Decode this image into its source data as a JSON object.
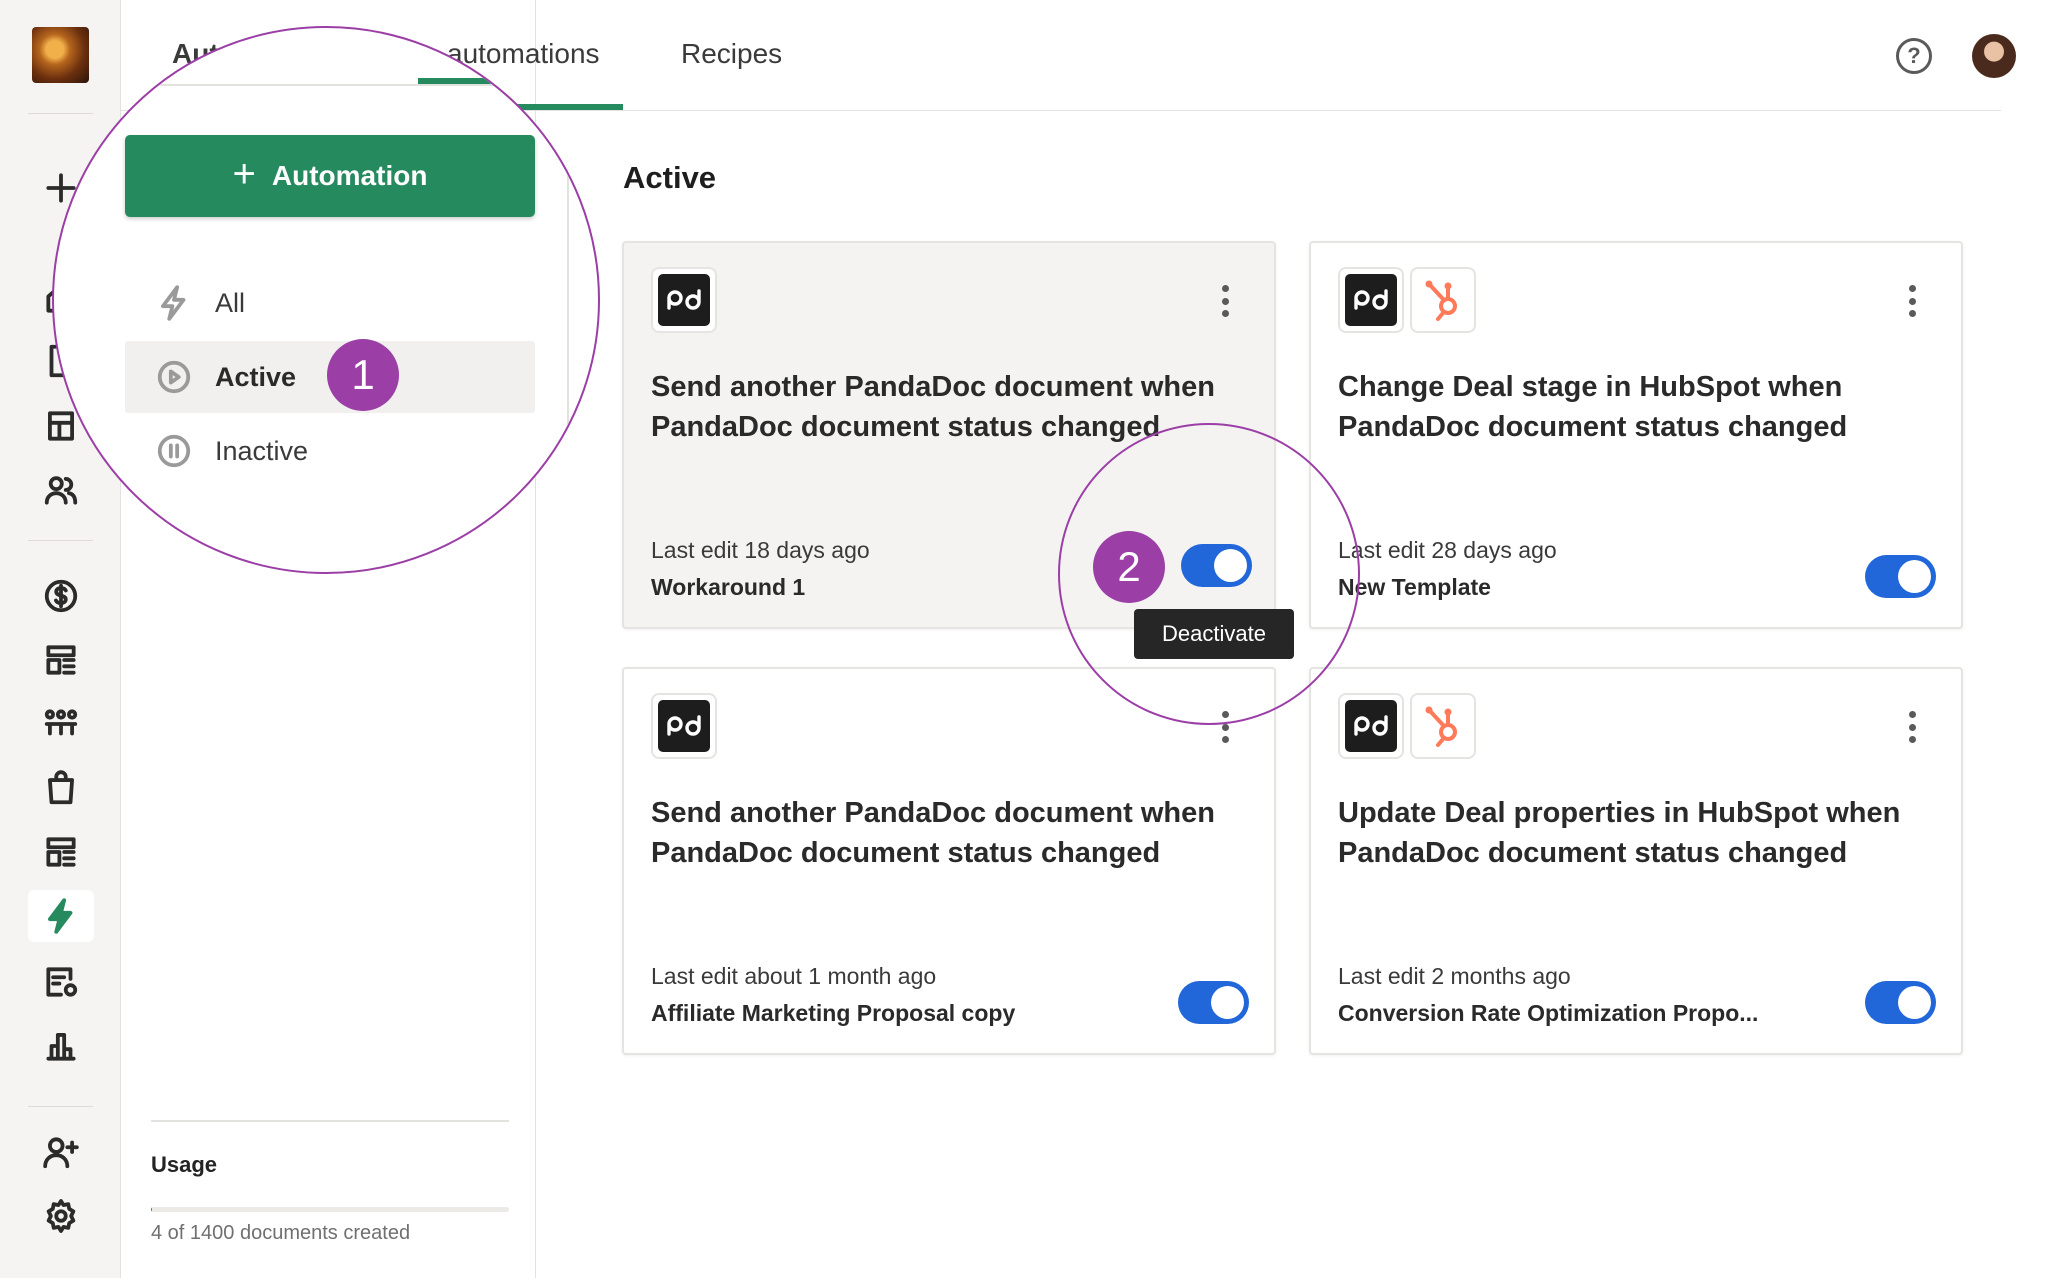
{
  "header": {
    "tabs": [
      {
        "label": "Automations"
      },
      {
        "label": "automations"
      },
      {
        "label": "Recipes"
      }
    ],
    "help_label": "?"
  },
  "sidebar": {
    "create_button": "Automation",
    "filters": [
      {
        "label": "All",
        "icon": "lightning-icon"
      },
      {
        "label": "Active",
        "icon": "play-circle-icon",
        "selected": true
      },
      {
        "label": "Inactive",
        "icon": "pause-circle-icon"
      }
    ],
    "usage": {
      "title": "Usage",
      "text": "4 of 1400 documents created",
      "used": 4,
      "total": 1400
    }
  },
  "main": {
    "section_title": "Active",
    "cards": [
      {
        "title": "Send another PandaDoc document when PandaDoc document status changed",
        "last_edit": "Last edit 18 days ago",
        "template": "Workaround 1",
        "apps": [
          "pandadoc-icon"
        ],
        "active": true
      },
      {
        "title": "Change Deal stage in HubSpot when PandaDoc document status changed",
        "last_edit": "Last edit 28 days ago",
        "template": "New Template",
        "apps": [
          "pandadoc-icon",
          "hubspot-icon"
        ],
        "active": true
      },
      {
        "title": "Send another PandaDoc document when PandaDoc document status changed",
        "last_edit": "Last edit about 1 month ago",
        "template": "Affiliate Marketing Proposal copy",
        "apps": [
          "pandadoc-icon"
        ],
        "active": true
      },
      {
        "title": "Update Deal properties in HubSpot when PandaDoc document status changed",
        "last_edit": "Last edit 2 months ago",
        "template": "Conversion Rate Optimization Propo...",
        "apps": [
          "pandadoc-icon",
          "hubspot-icon"
        ],
        "active": true
      }
    ],
    "tooltip": "Deactivate"
  },
  "callouts": [
    {
      "number": "1"
    },
    {
      "number": "2"
    }
  ],
  "colors": {
    "brand_green": "#268a5f",
    "toggle_blue": "#2167d9",
    "callout_purple": "#9b3ea6",
    "hubspot_orange": "#ff7a59"
  }
}
